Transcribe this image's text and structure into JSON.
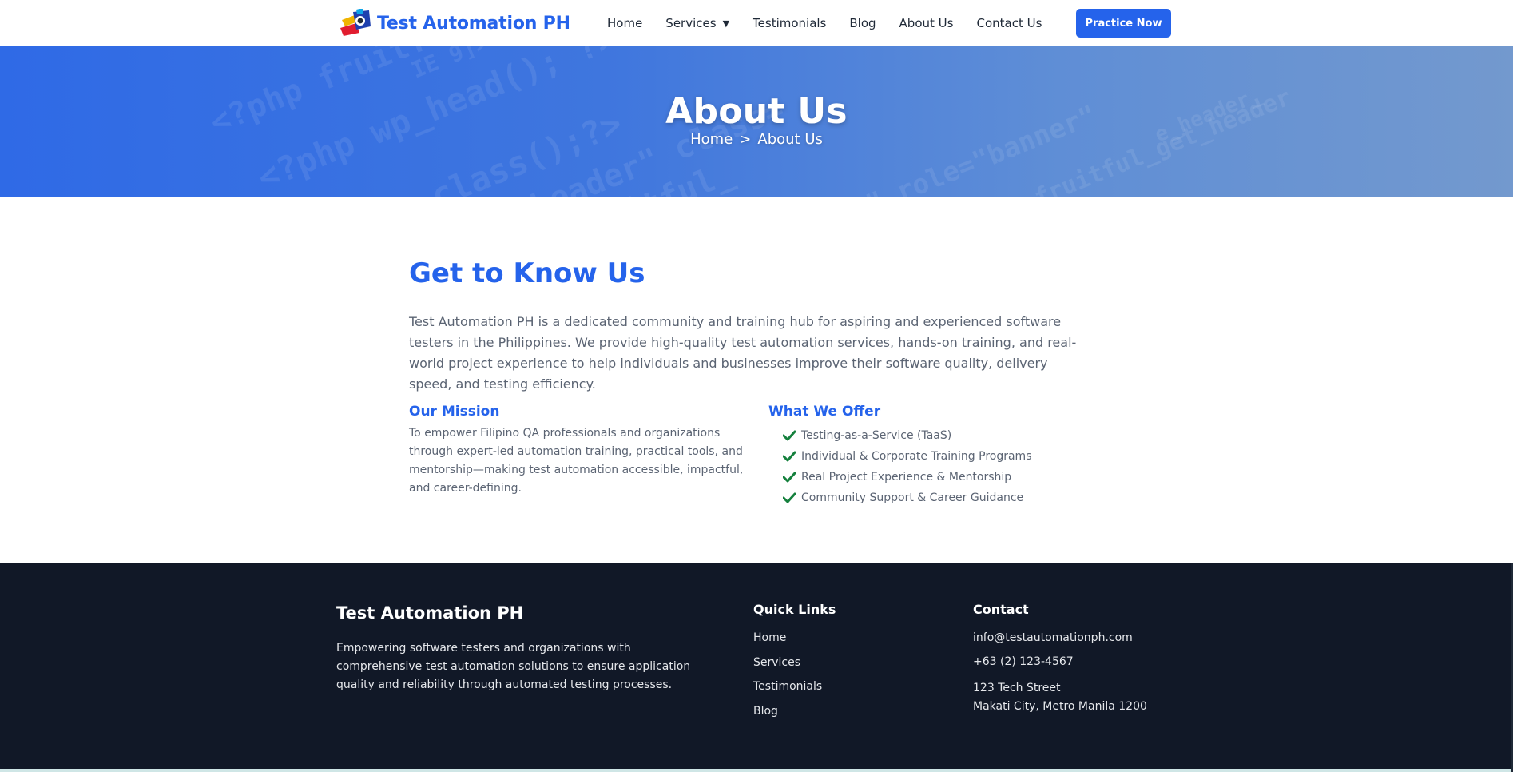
{
  "brand": {
    "name": "Test Automation PH"
  },
  "nav": {
    "items": [
      {
        "label": "Home"
      },
      {
        "label": "Services",
        "has_dropdown": true
      },
      {
        "label": "Testimonials"
      },
      {
        "label": "Blog"
      },
      {
        "label": "About Us"
      },
      {
        "label": "Contact Us"
      }
    ],
    "dropdown_caret": "▼",
    "cta_label": "Practice Now"
  },
  "hero": {
    "title": "About Us",
    "breadcrumb": {
      "home": "Home",
      "separator": ">",
      "current": "About Us"
    }
  },
  "about": {
    "heading": "Get to Know Us",
    "intro": "Test Automation PH is a dedicated community and training hub for aspiring and experienced software testers in the Philippines. We provide high-quality test automation services, hands-on training, and real-world project experience to help individuals and businesses improve their software quality, delivery speed, and testing efficiency.",
    "mission": {
      "heading": "Our Mission",
      "text": "To empower Filipino QA professionals and organizations through expert-led automation training, practical tools, and mentorship—making test automation accessible, impactful, and career-defining."
    },
    "offer": {
      "heading": "What We Offer",
      "items": [
        "Testing-as-a-Service (TaaS)",
        "Individual & Corporate Training Programs",
        "Real Project Experience & Mentorship",
        "Community Support & Career Guidance"
      ]
    }
  },
  "footer": {
    "brand": "Test Automation PH",
    "description": "Empowering software testers and organizations with comprehensive test automation solutions to ensure application quality and reliability through automated testing processes.",
    "quick_links": {
      "heading": "Quick Links",
      "items": [
        "Home",
        "Services",
        "Testimonials",
        "Blog"
      ]
    },
    "contact": {
      "heading": "Contact",
      "email": "info@testautomationph.com",
      "phone": "+63 (2) 123-4567",
      "address_line1": "123 Tech Street",
      "address_line2": "Makati City, Metro Manila 1200"
    }
  },
  "colors": {
    "accent": "#2563eb",
    "footer_bg": "#111827",
    "check_green": "#15803d"
  }
}
